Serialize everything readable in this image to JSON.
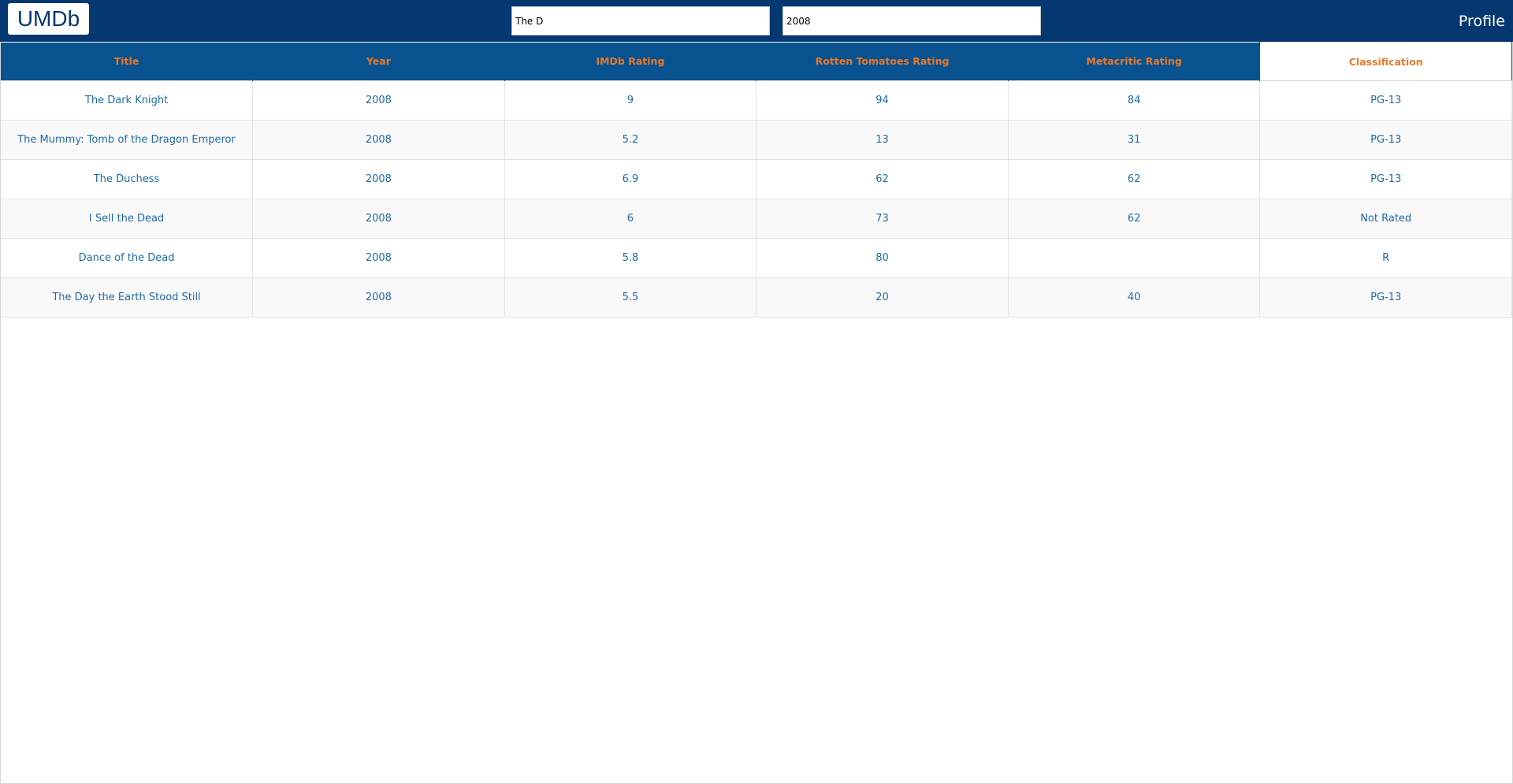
{
  "header": {
    "logo": "UMDb",
    "title_query": "The D",
    "year_query": "2008",
    "profile": "Profile"
  },
  "table": {
    "columns": [
      "Title",
      "Year",
      "IMDb Rating",
      "Rotten Tomatoes Rating",
      "Metacritic Rating",
      "Classification"
    ],
    "rows": [
      [
        "The Dark Knight",
        "2008",
        "9",
        "94",
        "84",
        "PG-13"
      ],
      [
        "The Mummy: Tomb of the Dragon Emperor",
        "2008",
        "5.2",
        "13",
        "31",
        "PG-13"
      ],
      [
        "The Duchess",
        "2008",
        "6.9",
        "62",
        "62",
        "PG-13"
      ],
      [
        "I Sell the Dead",
        "2008",
        "6",
        "73",
        "62",
        "Not Rated"
      ],
      [
        "Dance of the Dead",
        "2008",
        "5.8",
        "80",
        "",
        "R"
      ],
      [
        "The Day the Earth Stood Still",
        "2008",
        "5.5",
        "20",
        "40",
        "PG-13"
      ]
    ]
  },
  "colors": {
    "header_bg": "#053870",
    "table_header_bg": "#08528f",
    "header_text": "#e8782a",
    "cell_text": "#1f6aa5"
  }
}
